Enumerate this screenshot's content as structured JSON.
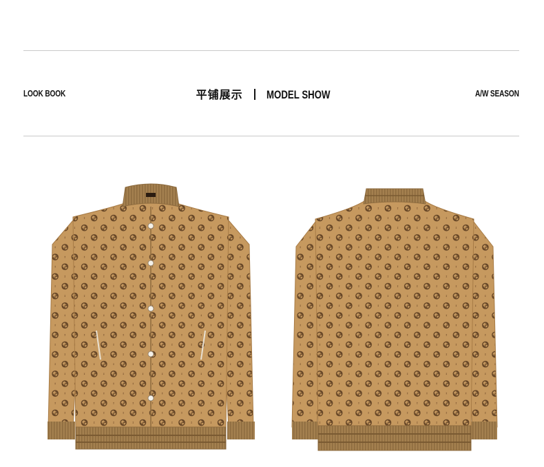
{
  "header": {
    "left_tag": "LOOK BOOK",
    "title_cn": "平铺展示",
    "title_en": "MODEL SHOW",
    "right_tag": "A/W SEASON"
  },
  "products": [
    {
      "view": "front",
      "icon": "jacket-front-image"
    },
    {
      "view": "back",
      "icon": "jacket-back-image"
    }
  ],
  "colors": {
    "fabric": "#c6995f",
    "fabric_dark": "#a77b46",
    "rib": "#a4804f",
    "rib_stripe": "#8d6b3f",
    "motif": "#5e3f22",
    "rule": "#c9c9c9"
  }
}
